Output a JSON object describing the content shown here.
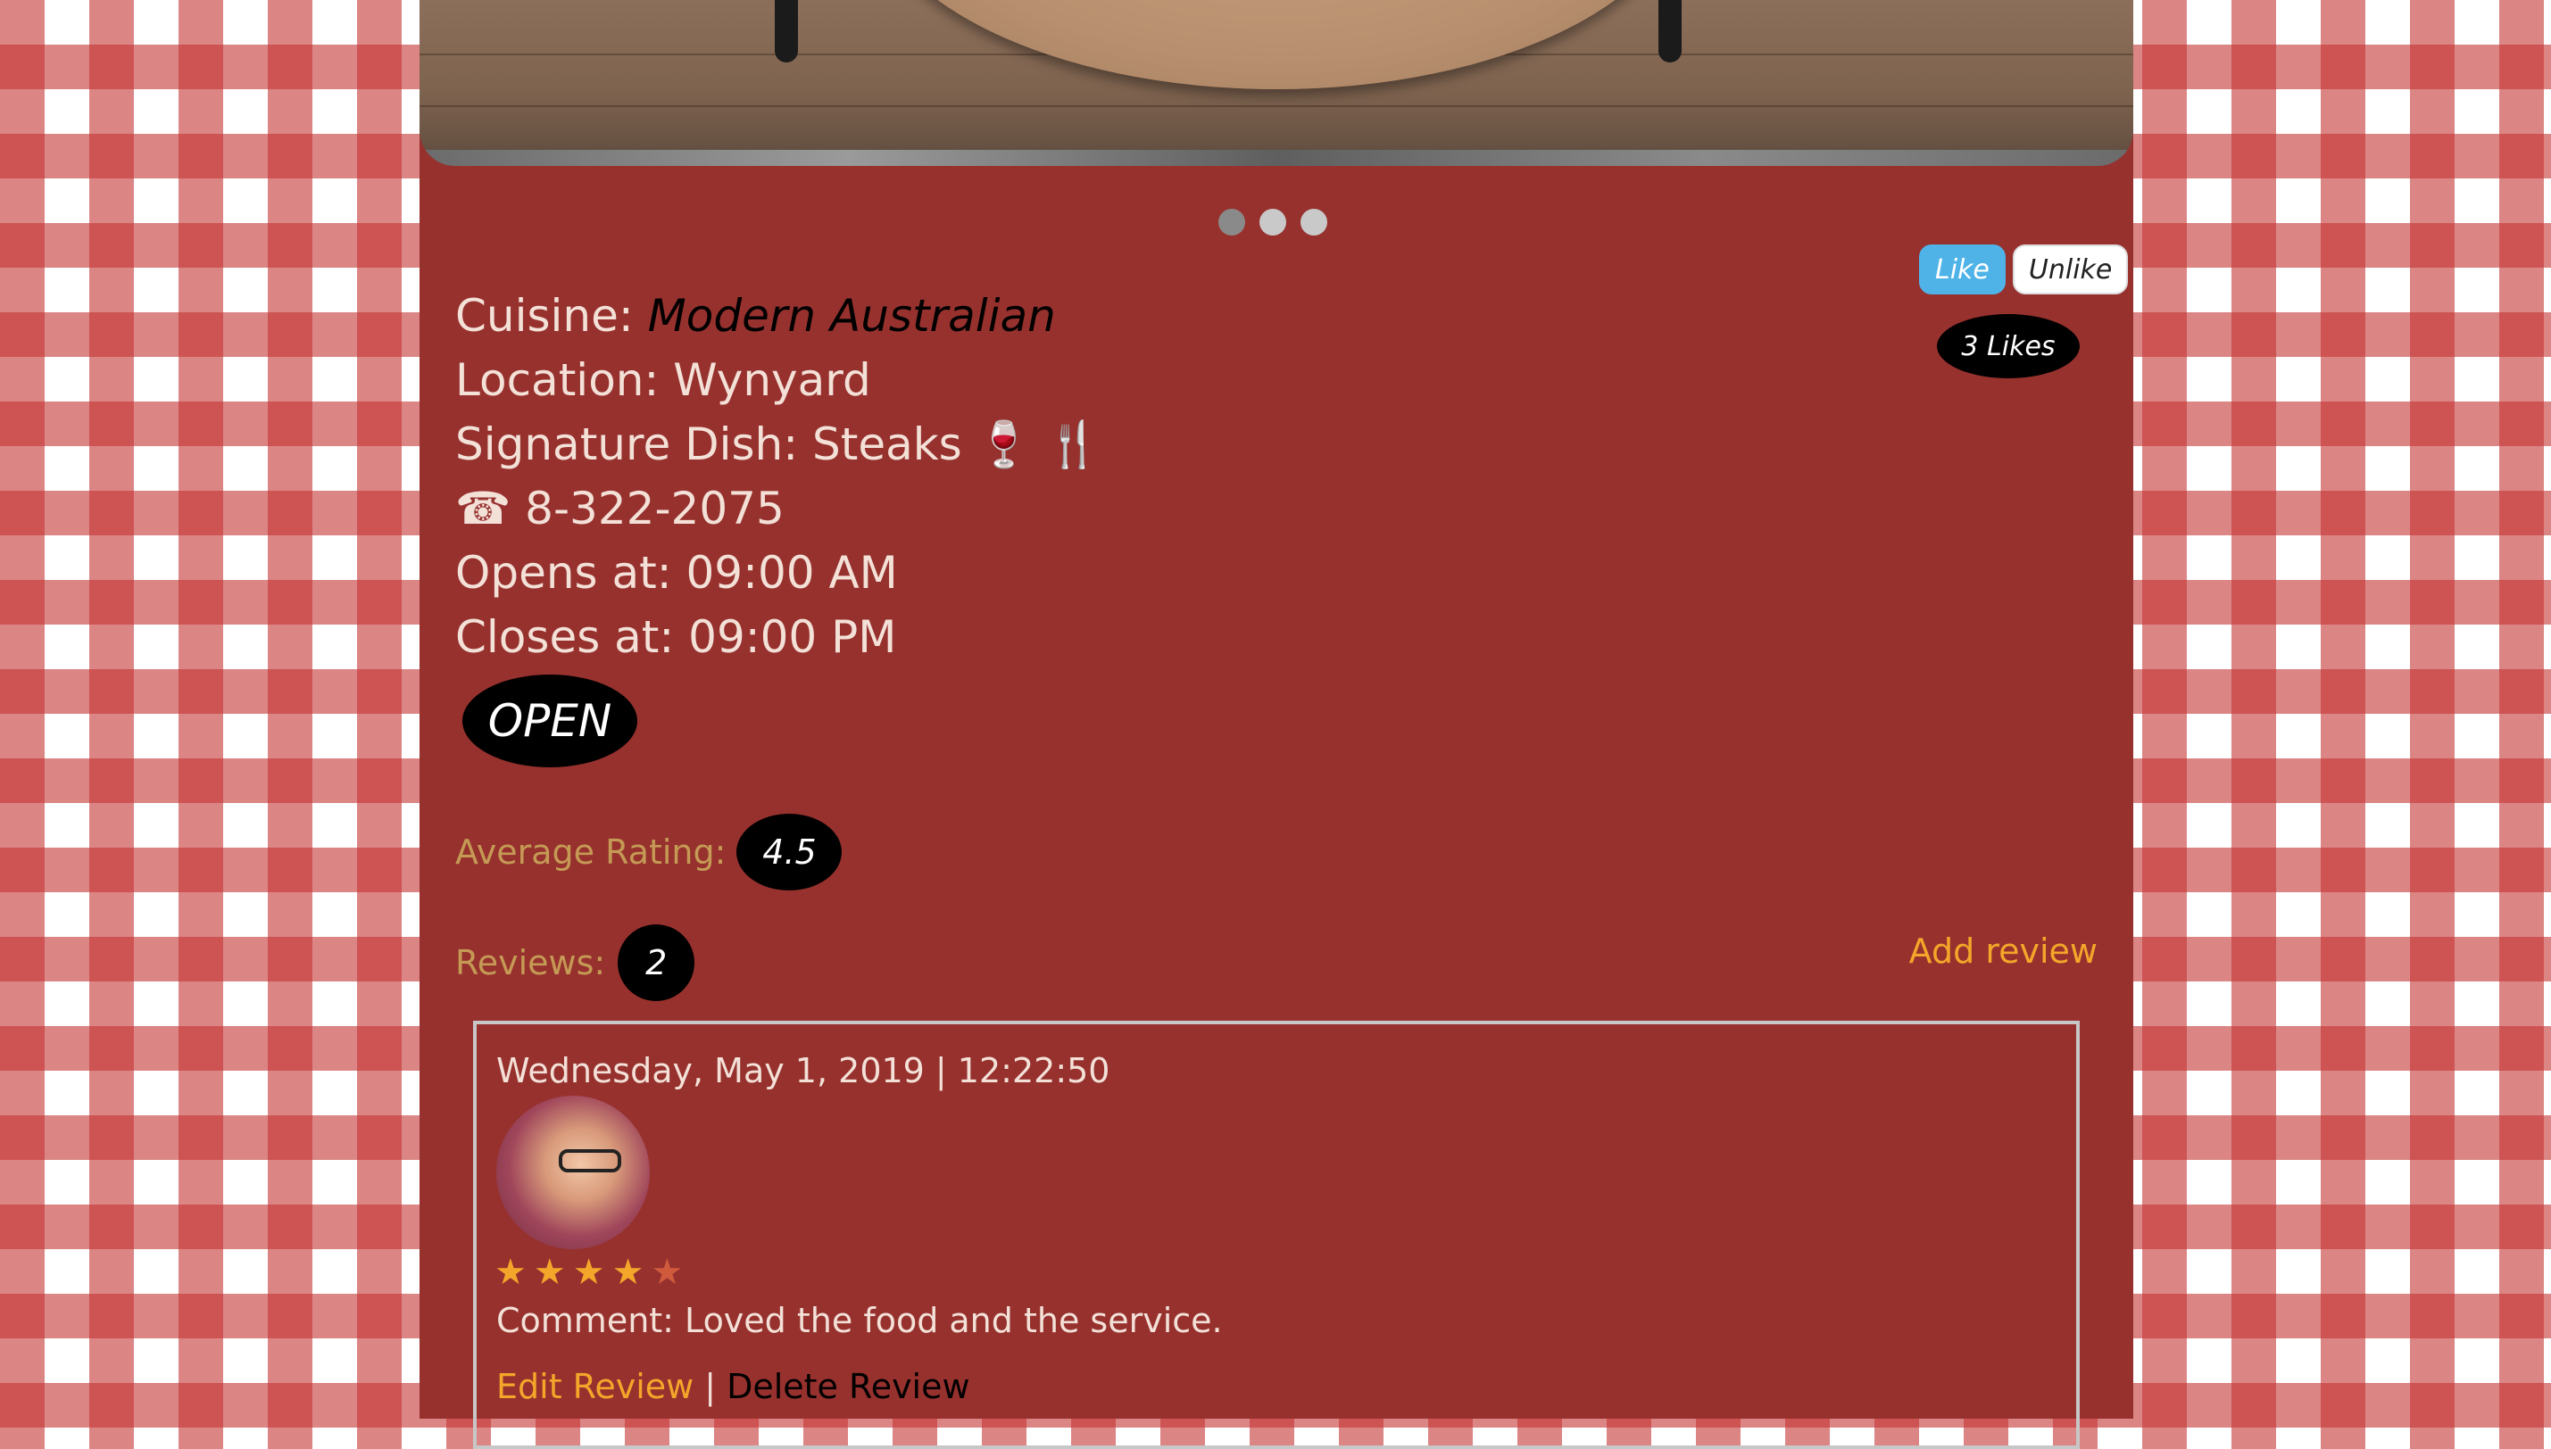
{
  "carousel": {
    "dots": 3,
    "active_index": 0
  },
  "likes": {
    "like_label": "Like",
    "unlike_label": "Unlike",
    "count_text": "3 Likes"
  },
  "restaurant": {
    "cuisine_label": "Cuisine: ",
    "cuisine_value": "Modern Australian",
    "location": "Location: Wynyard",
    "signature": "Signature Dish: Steaks 🍷 🍴",
    "phone": "☎ 8-322-2075",
    "opens": "Opens at: 09:00 AM",
    "closes": "Closes at: 09:00 PM",
    "status": "OPEN"
  },
  "ratings": {
    "average_label": "Average Rating:",
    "average_value": "4.5",
    "reviews_label": "Reviews:",
    "reviews_count": "2",
    "add_review": "Add review"
  },
  "review": {
    "date": "Wednesday, May 1, 2019 | 12:22:50",
    "stars": 4,
    "max_stars": 5,
    "comment": "Comment: Loved the food and the service.",
    "edit_label": "Edit Review",
    "separator": "|",
    "delete_label": "Delete Review"
  },
  "colors": {
    "panel": "#97312e",
    "accent": "#f4a62a",
    "gold_label": "#c59a55",
    "like_blue": "#4fb3e8"
  }
}
